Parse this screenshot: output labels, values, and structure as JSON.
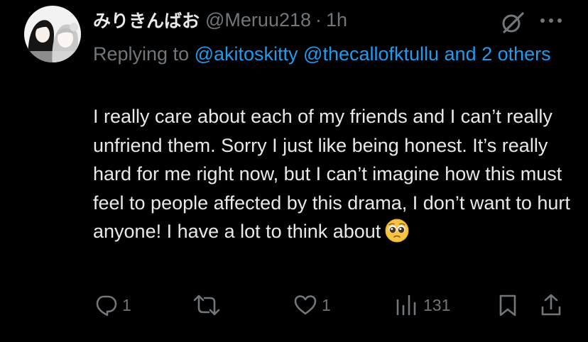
{
  "tweet": {
    "display_name": "みりきんばお",
    "handle": "@Meruu218",
    "separator": "·",
    "time": "1h",
    "replying_to_prefix": "Replying to ",
    "replying_to_users": "@akitoskitty @thecallofktullu and 2 others",
    "text": "I really care about each of my friends and  I can’t really unfriend them. Sorry I just like being honest. It’s really hard for me right now, but I can’t imagine how this must feel to people affected by this drama, I don’t want to hurt anyone! I have a lot to think about",
    "emoji": "pleading-face-emoji"
  },
  "actions": {
    "reply_count": "1",
    "retweet_count": "",
    "like_count": "1",
    "views_count": "131"
  },
  "icons": [
    "avatar-image",
    "grok-icon",
    "more-icon",
    "reply-icon",
    "retweet-icon",
    "like-icon",
    "views-icon",
    "bookmark-icon",
    "share-icon"
  ],
  "colors": {
    "background": "#000000",
    "text": "#e7e9ea",
    "secondary": "#71767b",
    "link": "#1d9bf0"
  }
}
